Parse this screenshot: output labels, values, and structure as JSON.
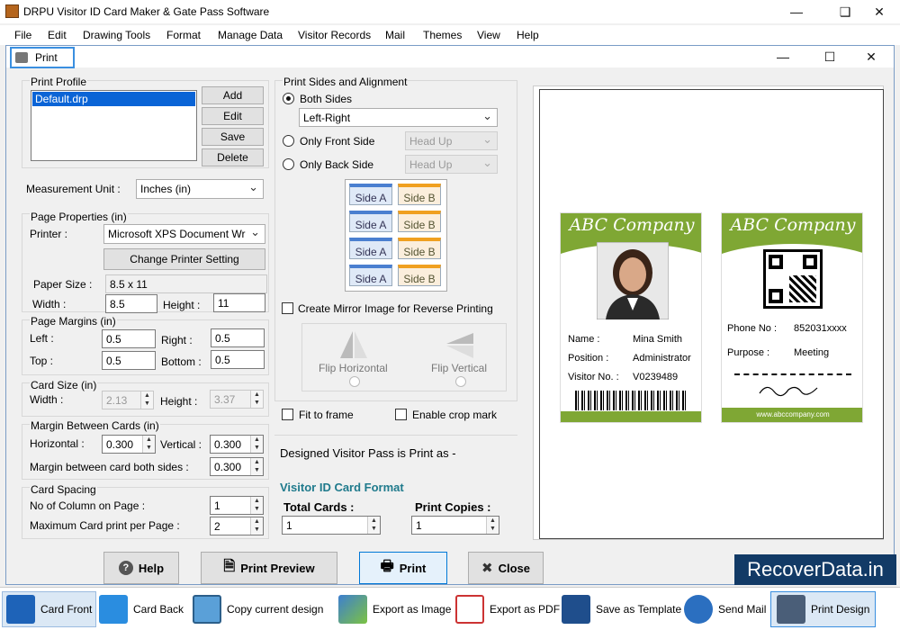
{
  "app": {
    "title": "DRPU Visitor ID Card Maker & Gate Pass Software"
  },
  "menu": [
    "File",
    "Edit",
    "Drawing Tools",
    "Format",
    "Manage Data",
    "Visitor Records",
    "Mail",
    "Themes",
    "View",
    "Help"
  ],
  "dialog": {
    "title": "Print"
  },
  "print_profile": {
    "legend": "Print Profile",
    "items": [
      "Default.drp"
    ],
    "add": "Add",
    "edit": "Edit",
    "save": "Save",
    "delete": "Delete"
  },
  "measurement": {
    "label": "Measurement Unit :",
    "value": "Inches (in)"
  },
  "page_properties": {
    "legend": "Page Properties (in)",
    "printer_label": "Printer :",
    "printer_value": "Microsoft XPS Document Wr",
    "change_printer": "Change Printer Setting",
    "paper_size_label": "Paper Size :",
    "paper_size": "8.5 x 11",
    "width_label": "Width :",
    "width": "8.5",
    "height_label": "Height :",
    "height": "11"
  },
  "page_margins": {
    "legend": "Page Margins (in)",
    "left_label": "Left :",
    "left": "0.5",
    "right_label": "Right :",
    "right": "0.5",
    "top_label": "Top :",
    "top": "0.5",
    "bottom_label": "Bottom :",
    "bottom": "0.5"
  },
  "card_size": {
    "legend": "Card Size (in)",
    "width_label": "Width :",
    "width": "2.13",
    "height_label": "Height :",
    "height": "3.37"
  },
  "margin_between": {
    "legend": "Margin Between Cards (in)",
    "horizontal_label": "Horizontal :",
    "horizontal": "0.300",
    "vertical_label": "Vertical :",
    "vertical": "0.300",
    "both_label": "Margin between card both sides :",
    "both": "0.300"
  },
  "card_spacing": {
    "legend": "Card Spacing",
    "columns_label": "No of Column on Page :",
    "columns": "1",
    "max_label": "Maximum Card print per Page :",
    "max": "2"
  },
  "print_sides": {
    "legend": "Print Sides and Alignment",
    "both": "Both Sides",
    "both_align": "Left-Right",
    "front": "Only Front Side",
    "front_align": "Head Up",
    "back": "Only Back Side",
    "back_align": "Head Up",
    "side_a": "Side A",
    "side_b": "Side B"
  },
  "mirror": {
    "label": "Create Mirror Image for Reverse Printing",
    "flip_h": "Flip Horizontal",
    "flip_v": "Flip Vertical"
  },
  "options": {
    "fit": "Fit to frame",
    "crop": "Enable crop mark"
  },
  "designed": {
    "text": "Designed Visitor Pass is Print as -",
    "format": "Visitor ID Card Format",
    "total_label": "Total Cards :",
    "total": "1",
    "copies_label": "Print Copies :",
    "copies": "1"
  },
  "card_front": {
    "company": "ABC Company",
    "name_label": "Name :",
    "name": "Mina Smith",
    "position_label": "Position :",
    "position": "Administrator",
    "visitor_label": "Visitor No. :",
    "visitor": "V0239489"
  },
  "card_back": {
    "company": "ABC Company",
    "phone_label": "Phone No :",
    "phone": "852031xxxx",
    "purpose_label": "Purpose :",
    "purpose": "Meeting",
    "website": "www.abccompany.com"
  },
  "buttons": {
    "help": "Help",
    "preview": "Print Preview",
    "print": "Print",
    "close": "Close"
  },
  "watermark": "RecoverData.in",
  "toolbar": [
    "Card Front",
    "Card Back",
    "Copy current design",
    "Export as Image",
    "Export as PDF",
    "Save as Template",
    "Send Mail",
    "Print Design"
  ],
  "colors": {
    "accent": "#7fa734",
    "tab_border": "#3a8fe0",
    "selection": "#0a64d6"
  }
}
